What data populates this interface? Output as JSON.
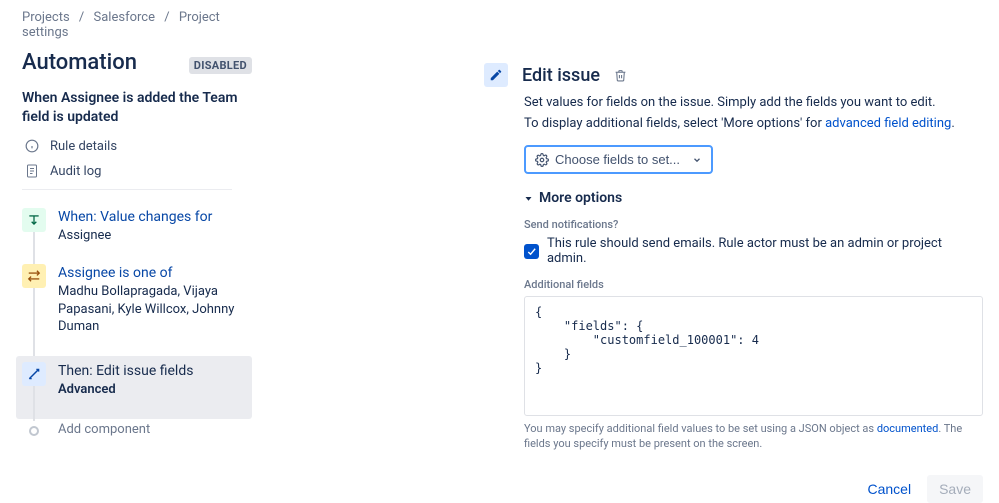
{
  "breadcrumb": {
    "projects": "Projects",
    "project": "Salesforce",
    "settings": "Project settings"
  },
  "title": "Automation",
  "badge": "DISABLED",
  "rule_title": "When Assignee is added the Team field is updated",
  "meta": {
    "rule_details": "Rule details",
    "audit_log": "Audit log"
  },
  "steps": {
    "when": {
      "head": "When: Value changes for",
      "sub": "Assignee"
    },
    "cond": {
      "head": "Assignee is one of",
      "sub": "Madhu Bollapragada, Vijaya Papasani, Kyle Willcox, Johnny Duman"
    },
    "then": {
      "head": "Then: Edit issue fields",
      "sub": "Advanced"
    },
    "add": "Add component"
  },
  "panel": {
    "title": "Edit issue",
    "desc1": "Set values for fields on the issue. Simply add the fields you want to edit.",
    "desc2_pre": "To display additional fields, select 'More options' for ",
    "desc2_link": "advanced field editing",
    "choose": "Choose fields to set...",
    "more_options": "More options",
    "send_label": "Send notifications?",
    "check_text": "This rule should send emails. Rule actor must be an admin or project admin.",
    "additional_label": "Additional fields",
    "code": "{\n    \"fields\": {\n        \"customfield_100001\": 4\n    }\n}",
    "hint_pre": "You may specify additional field values to be set using a JSON object as ",
    "hint_link": "documented",
    "hint_post": ". The fields you specify must be present on the screen."
  },
  "buttons": {
    "cancel": "Cancel",
    "save": "Save"
  }
}
